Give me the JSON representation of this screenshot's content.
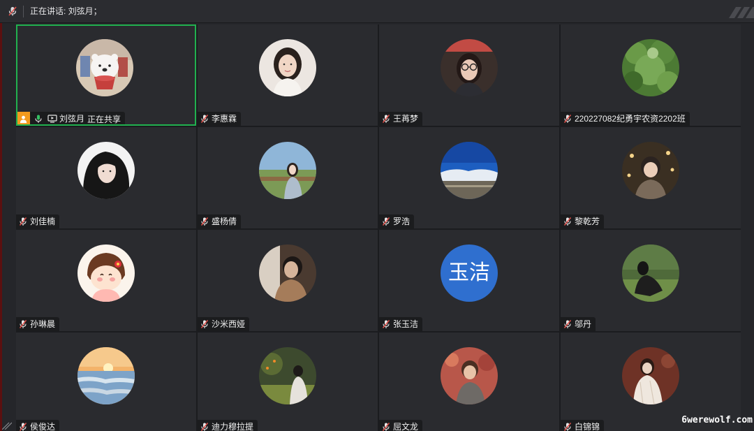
{
  "topbar": {
    "speaking_text": "正在讲话:  刘弦月；"
  },
  "host_tile": {
    "name": "刘弦月",
    "status": "正在共享"
  },
  "participants": [
    {
      "name": "李惠霖"
    },
    {
      "name": "王苒梦"
    },
    {
      "name": "220227082纪勇宇农资2202班"
    },
    {
      "name": "刘佳楠"
    },
    {
      "name": "盛杨倩"
    },
    {
      "name": "罗浩"
    },
    {
      "name": "黎乾芳"
    },
    {
      "name": "孙琳晨"
    },
    {
      "name": "沙米西娅"
    },
    {
      "name": "张玉洁",
      "avatar_text": "玉洁"
    },
    {
      "name": "邬丹"
    },
    {
      "name": "侯俊达"
    },
    {
      "name": "迪力穆拉提"
    },
    {
      "name": "屈文龙"
    },
    {
      "name": "白锦锦"
    }
  ],
  "watermark": "6werewolf.com",
  "colors": {
    "active_border": "#21b14f",
    "host_badge": "#f39a1e",
    "text_avatar_bg": "#2f6fcf",
    "muted_mic": "#e0504a"
  },
  "icons": {
    "muted_mic": "mic-muted-icon",
    "mic_on": "mic-icon",
    "screen_share": "screen-share-icon",
    "host": "host-person-icon"
  }
}
